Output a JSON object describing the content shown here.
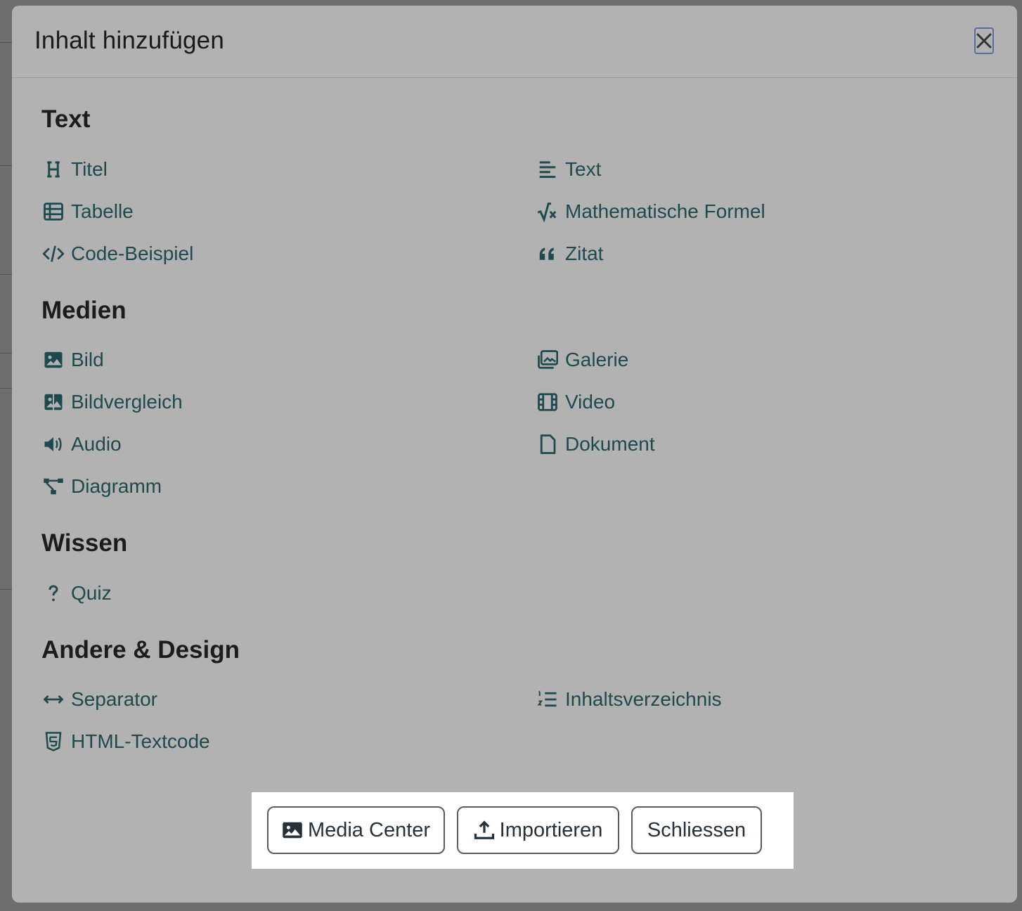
{
  "modal": {
    "title": "Inhalt hinzufügen",
    "close_label": "✕"
  },
  "sections": {
    "text": {
      "title": "Text",
      "items": [
        {
          "label": "Titel",
          "icon": "heading-icon"
        },
        {
          "label": "Text",
          "icon": "align-left-icon"
        },
        {
          "label": "Tabelle",
          "icon": "table-icon"
        },
        {
          "label": "Mathematische Formel",
          "icon": "square-root-icon"
        },
        {
          "label": "Code-Beispiel",
          "icon": "code-icon"
        },
        {
          "label": "Zitat",
          "icon": "quote-icon"
        }
      ]
    },
    "medien": {
      "title": "Medien",
      "items": [
        {
          "label": "Bild",
          "icon": "image-icon"
        },
        {
          "label": "Galerie",
          "icon": "images-icon"
        },
        {
          "label": "Bildvergleich",
          "icon": "image-compare-icon"
        },
        {
          "label": "Video",
          "icon": "film-icon"
        },
        {
          "label": "Audio",
          "icon": "volume-icon"
        },
        {
          "label": "Dokument",
          "icon": "file-icon"
        },
        {
          "label": "Diagramm",
          "icon": "diagram-icon"
        }
      ]
    },
    "wissen": {
      "title": "Wissen",
      "items": [
        {
          "label": "Quiz",
          "icon": "question-icon"
        }
      ]
    },
    "andere": {
      "title": "Andere & Design",
      "items": [
        {
          "label": "Separator",
          "icon": "arrows-horizontal-icon"
        },
        {
          "label": "Inhaltsverzeichnis",
          "icon": "list-ordered-icon"
        },
        {
          "label": "HTML-Textcode",
          "icon": "html5-icon"
        }
      ]
    }
  },
  "footer": {
    "media_center": "Media Center",
    "importieren": "Importieren",
    "schliessen": "Schliessen"
  }
}
